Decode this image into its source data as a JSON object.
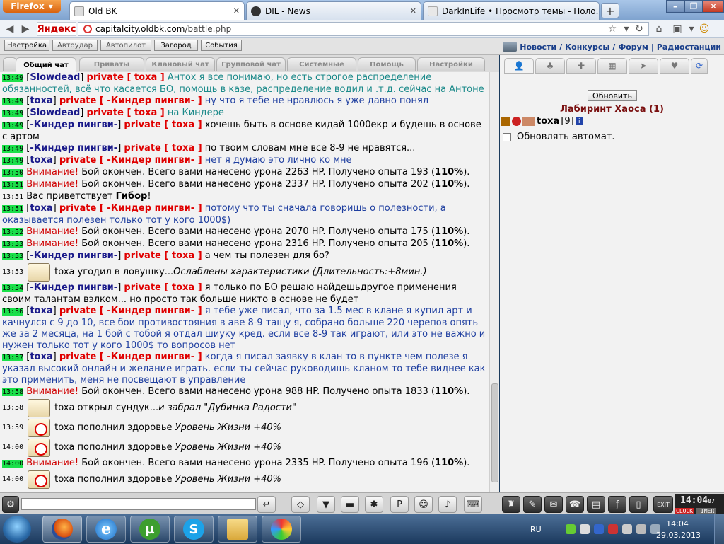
{
  "browser": {
    "firefox_label": "Firefox",
    "tabs": [
      {
        "title": "Old BK",
        "active": true
      },
      {
        "title": "DIL - News",
        "active": false
      },
      {
        "title": "DarkInLife • Просмотр темы - Поло...",
        "active": false
      }
    ],
    "newtab_label": "+",
    "yandex_label": "Яндекс",
    "url_domain": "capitalcity.oldbk.com",
    "url_path": "/battle.php"
  },
  "gamebar": {
    "buttons": [
      "Настройка",
      "Автоудар",
      "Автопилот",
      "Загород",
      "События"
    ],
    "links": [
      "Новости",
      "Конкурсы",
      "Форум",
      "Радиостанции"
    ]
  },
  "chat_tabs": [
    "Общий чат",
    "Приваты",
    "Клановый чат",
    "Групповой чат",
    "Системные",
    "Помощь",
    "Настройки"
  ],
  "messages": [
    {
      "time": "13:49",
      "g": true,
      "nick": "Slowdead",
      "priv": "toxa",
      "text": "Антох я все понимаю, но есть строгое распределение обязанностей, всё что касается БО, помощь в казе, распределение водил и .т.д. сейчас на Антоне",
      "cls": "teal"
    },
    {
      "time": "13:49",
      "g": true,
      "nick": "toxa",
      "priv": "-Киндер пингви-",
      "text": "ну что я тебе не нравлюсь я уже давно понял",
      "cls": "blue"
    },
    {
      "time": "13:49",
      "g": true,
      "nick": "Slowdead",
      "priv": "toxa",
      "text": "на Киндере",
      "cls": "teal"
    },
    {
      "time": "13:49",
      "g": true,
      "nick": "-Киндер пингви-",
      "priv": "toxa",
      "text": "хочешь быть в основе кидай 1000екр и будешь в основе с артом",
      "cls": ""
    },
    {
      "time": "13:49",
      "g": true,
      "nick": "-Киндер пингви-",
      "priv": "toxa",
      "text": "по твоим словам мне все 8-9 не нравятся...",
      "cls": ""
    },
    {
      "time": "13:49",
      "g": true,
      "nick": "toxa",
      "priv": "-Киндер пингви-",
      "text": "нет я думаю это лично ко мне",
      "cls": "blue"
    },
    {
      "time": "13:50",
      "g": true,
      "sys": true,
      "warn": "Внимание!",
      "text": "Бой окончен. Всего вами нанесено урона 2263 HP. Получено опыта 193 (",
      "bold": "110%",
      "end": ")."
    },
    {
      "time": "13:51",
      "g": true,
      "sys": true,
      "warn": "Внимание!",
      "text": "Бой окончен. Всего вами нанесено урона 2337 HP. Получено опыта 202 (",
      "bold": "110%",
      "end": ")."
    },
    {
      "time": "13:51",
      "g": false,
      "greet": "Вас приветствует ",
      "greet_name": "Гибор",
      "greet_end": "!"
    },
    {
      "time": "13:51",
      "g": true,
      "nick": "toxa",
      "priv": "-Киндер пингви-",
      "text": "потому что ты сначала говоришь о полезности, а оказывается полезен только тот у кого 1000$)",
      "cls": "blue"
    },
    {
      "time": "13:52",
      "g": true,
      "sys": true,
      "warn": "Внимание!",
      "text": "Бой окончен. Всего вами нанесено урона 2070 HP. Получено опыта 175 (",
      "bold": "110%",
      "end": ")."
    },
    {
      "time": "13:53",
      "g": true,
      "sys": true,
      "warn": "Внимание!",
      "text": "Бой окончен. Всего вами нанесено урона 2316 HP. Получено опыта 205 (",
      "bold": "110%",
      "end": ")."
    },
    {
      "time": "13:53",
      "g": true,
      "nick": "-Киндер пингви-",
      "priv": "toxa",
      "text": "а чем ты полезен для бо?",
      "cls": ""
    },
    {
      "time": "13:53",
      "g": false,
      "icon": "trap",
      "plain": "toxa угодил в ловушку...",
      "ital": "Ослаблены характеристики (Длительность:+8мин.)"
    },
    {
      "time": "13:54",
      "g": true,
      "nick": "-Киндер пингви-",
      "priv": "toxa",
      "text": "я только по БО решаю найдешьдругое применения своим талантам вэлком... но просто так больше никто в основе не будет",
      "cls": ""
    },
    {
      "time": "13:56",
      "g": true,
      "nick": "toxa",
      "priv": "-Киндер пингви-",
      "text": "я тебе уже писал, что за 1.5 мес в клане я купил арт и качнулся с 9 до 10, все бои противостояния в аве 8-9 тащу я, собрано больше 220 черепов опять же за 2 месяца, на 1 бой с тобой я отдал шиуку кред. если все 8-9 так играют, или это не важно и нужен только тот у кого 1000$ то вопросов нет",
      "cls": "blue"
    },
    {
      "time": "13:57",
      "g": true,
      "nick": "toxa",
      "priv": "-Киндер пингви-",
      "text": "когда я писал заявку в клан то в пункте чем полезе я указал высокий онлайн и желание играть. если ты сейчас руководишь кланом то тебе виднее как это применить, меня не посвещают в управление",
      "cls": "blue"
    },
    {
      "time": "13:58",
      "g": true,
      "sys": true,
      "warn": "Внимание!",
      "text": "Бой окончен. Всего вами нанесено урона 988 HP. Получено опыта 1833 (",
      "bold": "110%",
      "end": ")."
    },
    {
      "time": "13:58",
      "g": false,
      "icon": "chest",
      "plain": "toxa открыл сундук...",
      "ital": "и забрал \"Дубинка Радости\""
    },
    {
      "time": "13:59",
      "g": false,
      "icon": "hp",
      "plain": "toxa пополнил здоровье ",
      "ital": "Уровень Жизни +40%"
    },
    {
      "time": "14:00",
      "g": false,
      "icon": "hp",
      "plain": "toxa пополнил здоровье ",
      "ital": "Уровень Жизни +40%"
    },
    {
      "time": "14:00",
      "g": true,
      "sys": true,
      "warn": "Внимание!",
      "text": "Бой окончен. Всего вами нанесено урона 2335 HP. Получено опыта 196 (",
      "bold": "110%",
      "end": ")."
    },
    {
      "time": "14:00",
      "g": false,
      "icon": "hp",
      "plain": "toxa пополнил здоровье ",
      "ital": "Уровень Жизни +40%"
    }
  ],
  "right": {
    "refresh_label": "Обновить",
    "location": "Лабиринт Хаоса (1)",
    "player_name": "toxa",
    "player_level": "[9]",
    "auto_label": "Обновлять автомат."
  },
  "clock": {
    "time": "14:04",
    "sec": "07",
    "clock_lbl": "CLOCK",
    "timer_lbl": "TIMER"
  },
  "taskbar": {
    "lang": "RU",
    "time": "14:04",
    "date": "29.03.2013"
  },
  "colors": {
    "time_highlight": "#1be04a",
    "private": "#e00000",
    "nick": "#1a1a8a"
  }
}
